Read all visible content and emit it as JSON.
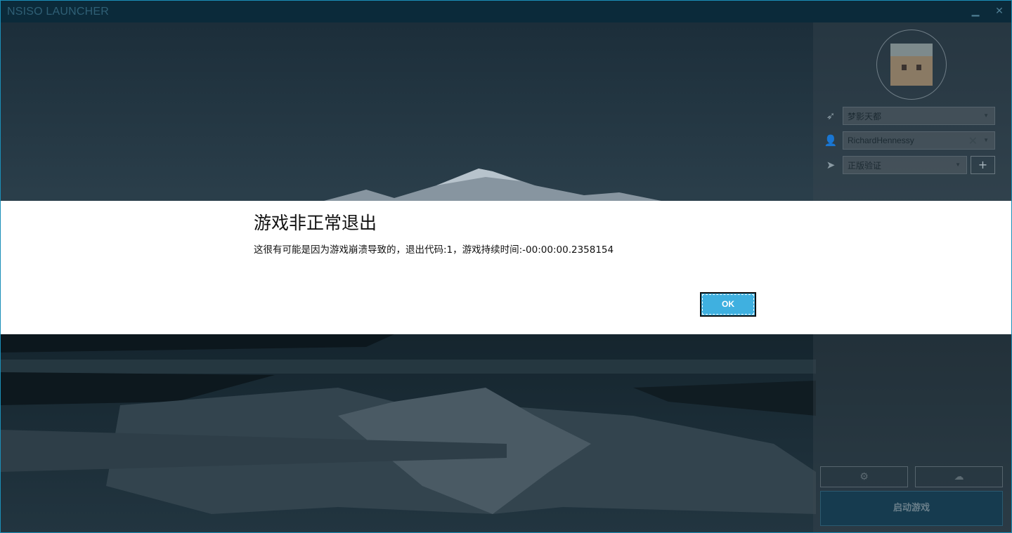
{
  "app": {
    "title": "NSISO LAUNCHER",
    "minimize_glyph": "▁",
    "close_glyph": "✕"
  },
  "sidebar": {
    "server_select": {
      "value": "梦影天都",
      "icon": "rocket-icon"
    },
    "user_select": {
      "value": "RichardHennessy",
      "icon": "user-icon"
    },
    "auth_select": {
      "value": "正版验证",
      "icon": "send-icon"
    },
    "add_button": "+",
    "settings_icon": "gear-icon",
    "download_icon": "cloud-download-icon",
    "launch_button": "启动游戏"
  },
  "dialog": {
    "title": "游戏非正常退出",
    "message": "这很有可能是因为游戏崩溃导致的，退出代码:1，游戏持续时间:-00:00:00.2358154",
    "ok_button": "OK"
  },
  "colors": {
    "accent": "#3fb0e0",
    "titlebar": "#0b2a3a",
    "border": "#1b8fb8"
  }
}
